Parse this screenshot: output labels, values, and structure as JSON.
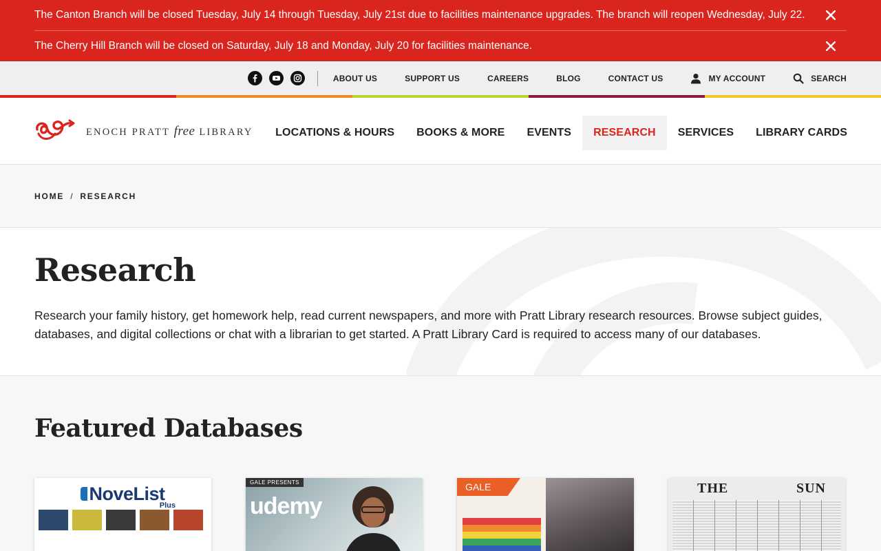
{
  "alerts": [
    {
      "text": "The Canton Branch will be closed Tuesday, July 14 through Tuesday, July 21st due to facilities maintenance upgrades. The branch will reopen Wednesday, July 22."
    },
    {
      "text": "The Cherry Hill Branch will be closed on Saturday, July 18 and Monday, July 20 for facilities maintenance."
    }
  ],
  "utility": {
    "social": [
      "facebook-icon",
      "youtube-icon",
      "instagram-icon"
    ],
    "links": {
      "about": "ABOUT US",
      "support": "SUPPORT US",
      "careers": "CAREERS",
      "blog": "BLOG",
      "contact": "CONTACT US",
      "account": "MY ACCOUNT",
      "search": "SEARCH"
    }
  },
  "brand": {
    "name_part1": "ENOCH PRATT ",
    "name_free": "free",
    "name_part2": " LIBRARY",
    "colors": {
      "red": "#d9251d",
      "orange": "#f08a22",
      "green": "#b8d433",
      "maroon": "#8c1c42",
      "yellow": "#f5c32d"
    }
  },
  "nav": {
    "items": [
      {
        "label": "LOCATIONS & HOURS"
      },
      {
        "label": "BOOKS & MORE"
      },
      {
        "label": "EVENTS"
      },
      {
        "label": "RESEARCH",
        "active": true
      },
      {
        "label": "SERVICES"
      },
      {
        "label": "LIBRARY CARDS"
      }
    ]
  },
  "breadcrumb": {
    "home": "HOME",
    "separator": "/",
    "current": "RESEARCH"
  },
  "hero": {
    "title": "Research",
    "description": "Research your family history, get homework help, read current newspapers, and more with Pratt Library research resources. Browse subject guides, databases, and digital collections or chat with a librarian to get started. A Pratt Library Card is required to access many of our databases."
  },
  "featured": {
    "title": "Featured Databases",
    "cards": {
      "novelist": {
        "title": "NoveList",
        "plus": "Plus",
        "book_captions": [
          "",
          "",
          "",
          "",
          ""
        ]
      },
      "udemy": {
        "tag": "GALE PRESENTS",
        "logo": "udemy"
      },
      "gale": {
        "badge": "GALE"
      },
      "sun": {
        "title_left": "THE",
        "title_right": "SUN"
      }
    }
  }
}
